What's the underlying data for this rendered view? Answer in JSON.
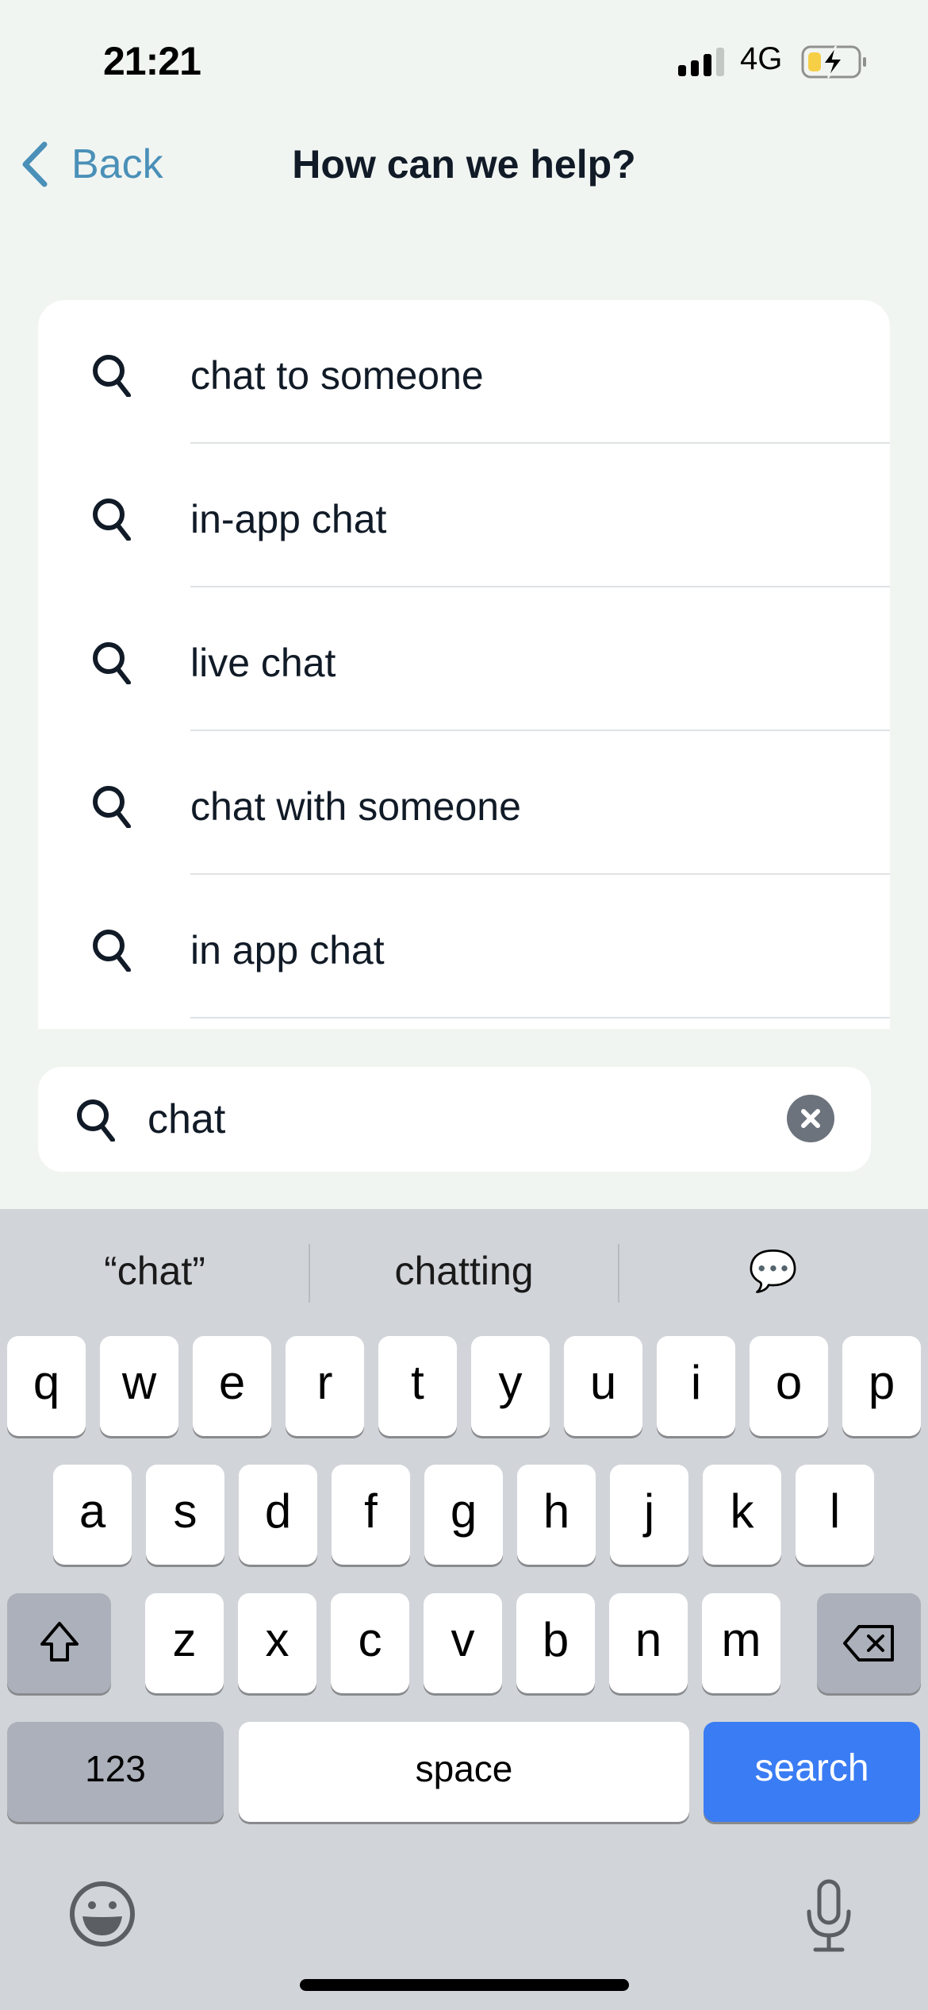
{
  "status_bar": {
    "time": "21:21",
    "network": "4G",
    "signal_bars": 3,
    "signal_bars_total": 4,
    "battery_level": "low",
    "battery_charging": true,
    "battery_color": "#f7cf47"
  },
  "nav": {
    "back_label": "Back",
    "title": "How can we help?",
    "accent_color": "#4a90b8"
  },
  "suggestions": [
    {
      "label": "chat to someone",
      "icon": "search-icon"
    },
    {
      "label": "in-app chat",
      "icon": "search-icon"
    },
    {
      "label": "live chat",
      "icon": "search-icon"
    },
    {
      "label": "chat with someone",
      "icon": "search-icon"
    },
    {
      "label": "in app chat",
      "icon": "search-icon"
    }
  ],
  "search": {
    "value": "chat",
    "icon": "search-icon",
    "clear_icon": "clear-icon"
  },
  "keyboard": {
    "predictions": [
      "“chat”",
      "chatting",
      "💬"
    ],
    "row1": [
      "q",
      "w",
      "e",
      "r",
      "t",
      "y",
      "u",
      "i",
      "o",
      "p"
    ],
    "row2": [
      "a",
      "s",
      "d",
      "f",
      "g",
      "h",
      "j",
      "k",
      "l"
    ],
    "row3": [
      "z",
      "x",
      "c",
      "v",
      "b",
      "n",
      "m"
    ],
    "shift_icon": "shift-icon",
    "delete_icon": "delete-icon",
    "numbers_label": "123",
    "space_label": "space",
    "action_label": "search",
    "action_color": "#3a7cf4",
    "emoji_icon": "emoji-icon",
    "mic_icon": "microphone-icon"
  }
}
